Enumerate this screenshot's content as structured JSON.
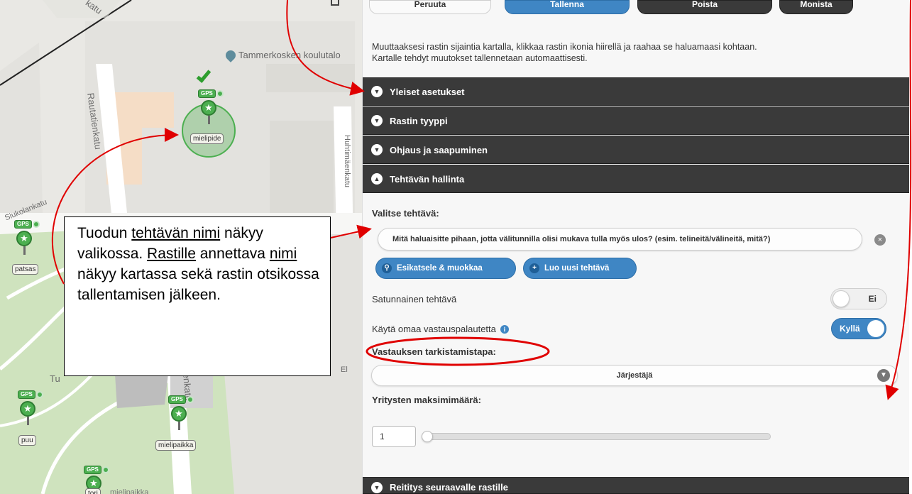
{
  "top_buttons": {
    "cancel": "Peruuta",
    "save": "Tallenna",
    "delete": "Poista",
    "duplicate": "Monista"
  },
  "info": {
    "line1": "Muuttaaksesi rastin sijaintia kartalla, klikkaa rastin ikonia hiirellä ja raahaa se haluamaasi kohtaan.",
    "line2": "Kartalle tehdyt muutokset tallennetaan automaattisesti."
  },
  "sections": {
    "general": "Yleiset asetukset",
    "type": "Rastin tyyppi",
    "guidance": "Ohjaus ja saapuminen",
    "task_mgmt": "Tehtävän hallinta",
    "routing": "Reititys seuraavalle rastille"
  },
  "task_mgmt": {
    "select_label": "Valitse tehtävä:",
    "selected_task": "Mitä haluaisitte pihaan, jotta välitunnilla olisi mukava tulla myös ulos? (esim. telineitä/välineitä, mitä?)",
    "preview_button": "Esikatsele & muokkaa",
    "new_button": "Luo uusi tehtävä",
    "random_label": "Satunnainen tehtävä",
    "random_value": "Ei",
    "own_feedback_label": "Käytä omaa vastauspalautetta",
    "own_feedback_value": "Kyllä",
    "check_method_label": "Vastauksen tarkistamistapa:",
    "check_method_value": "Järjestäjä",
    "max_attempts_label": "Yritysten maksimimäärä:",
    "max_attempts_value": "1"
  },
  "map": {
    "poi_name": "Tammerkosken koulutalo",
    "streets": {
      "rautatienkatu": "Rautatienkatu",
      "huhtimaenkatu": "Huhtimäenkatu",
      "siukolankatu": "Siukolankatu",
      "kenkatu": "enkatu",
      "katu_top": "katu",
      "tu": "Tu",
      "el": "El"
    },
    "gps": "GPS",
    "markers": [
      {
        "label": "mielipide"
      },
      {
        "label": "patsas"
      },
      {
        "label": "puu"
      },
      {
        "label": "mielipaikka"
      },
      {
        "label": "tori"
      }
    ],
    "partial_label": "mielipaikka"
  },
  "callout": {
    "p1": "Tuodun ",
    "p1_u": "tehtävän nimi",
    "p2": " näkyy valikossa. ",
    "p2_u": "Rastille",
    "p3": " annettava ",
    "p3_u": "nimi",
    "p4": " näkyy kartassa sekä rastin otsikossa tallentamisen jälkeen."
  },
  "colors": {
    "accent_blue": "#3f86c4",
    "dark_bar": "#3a3a3a",
    "marker_green": "#4caf50",
    "annotation_red": "#e00000"
  }
}
